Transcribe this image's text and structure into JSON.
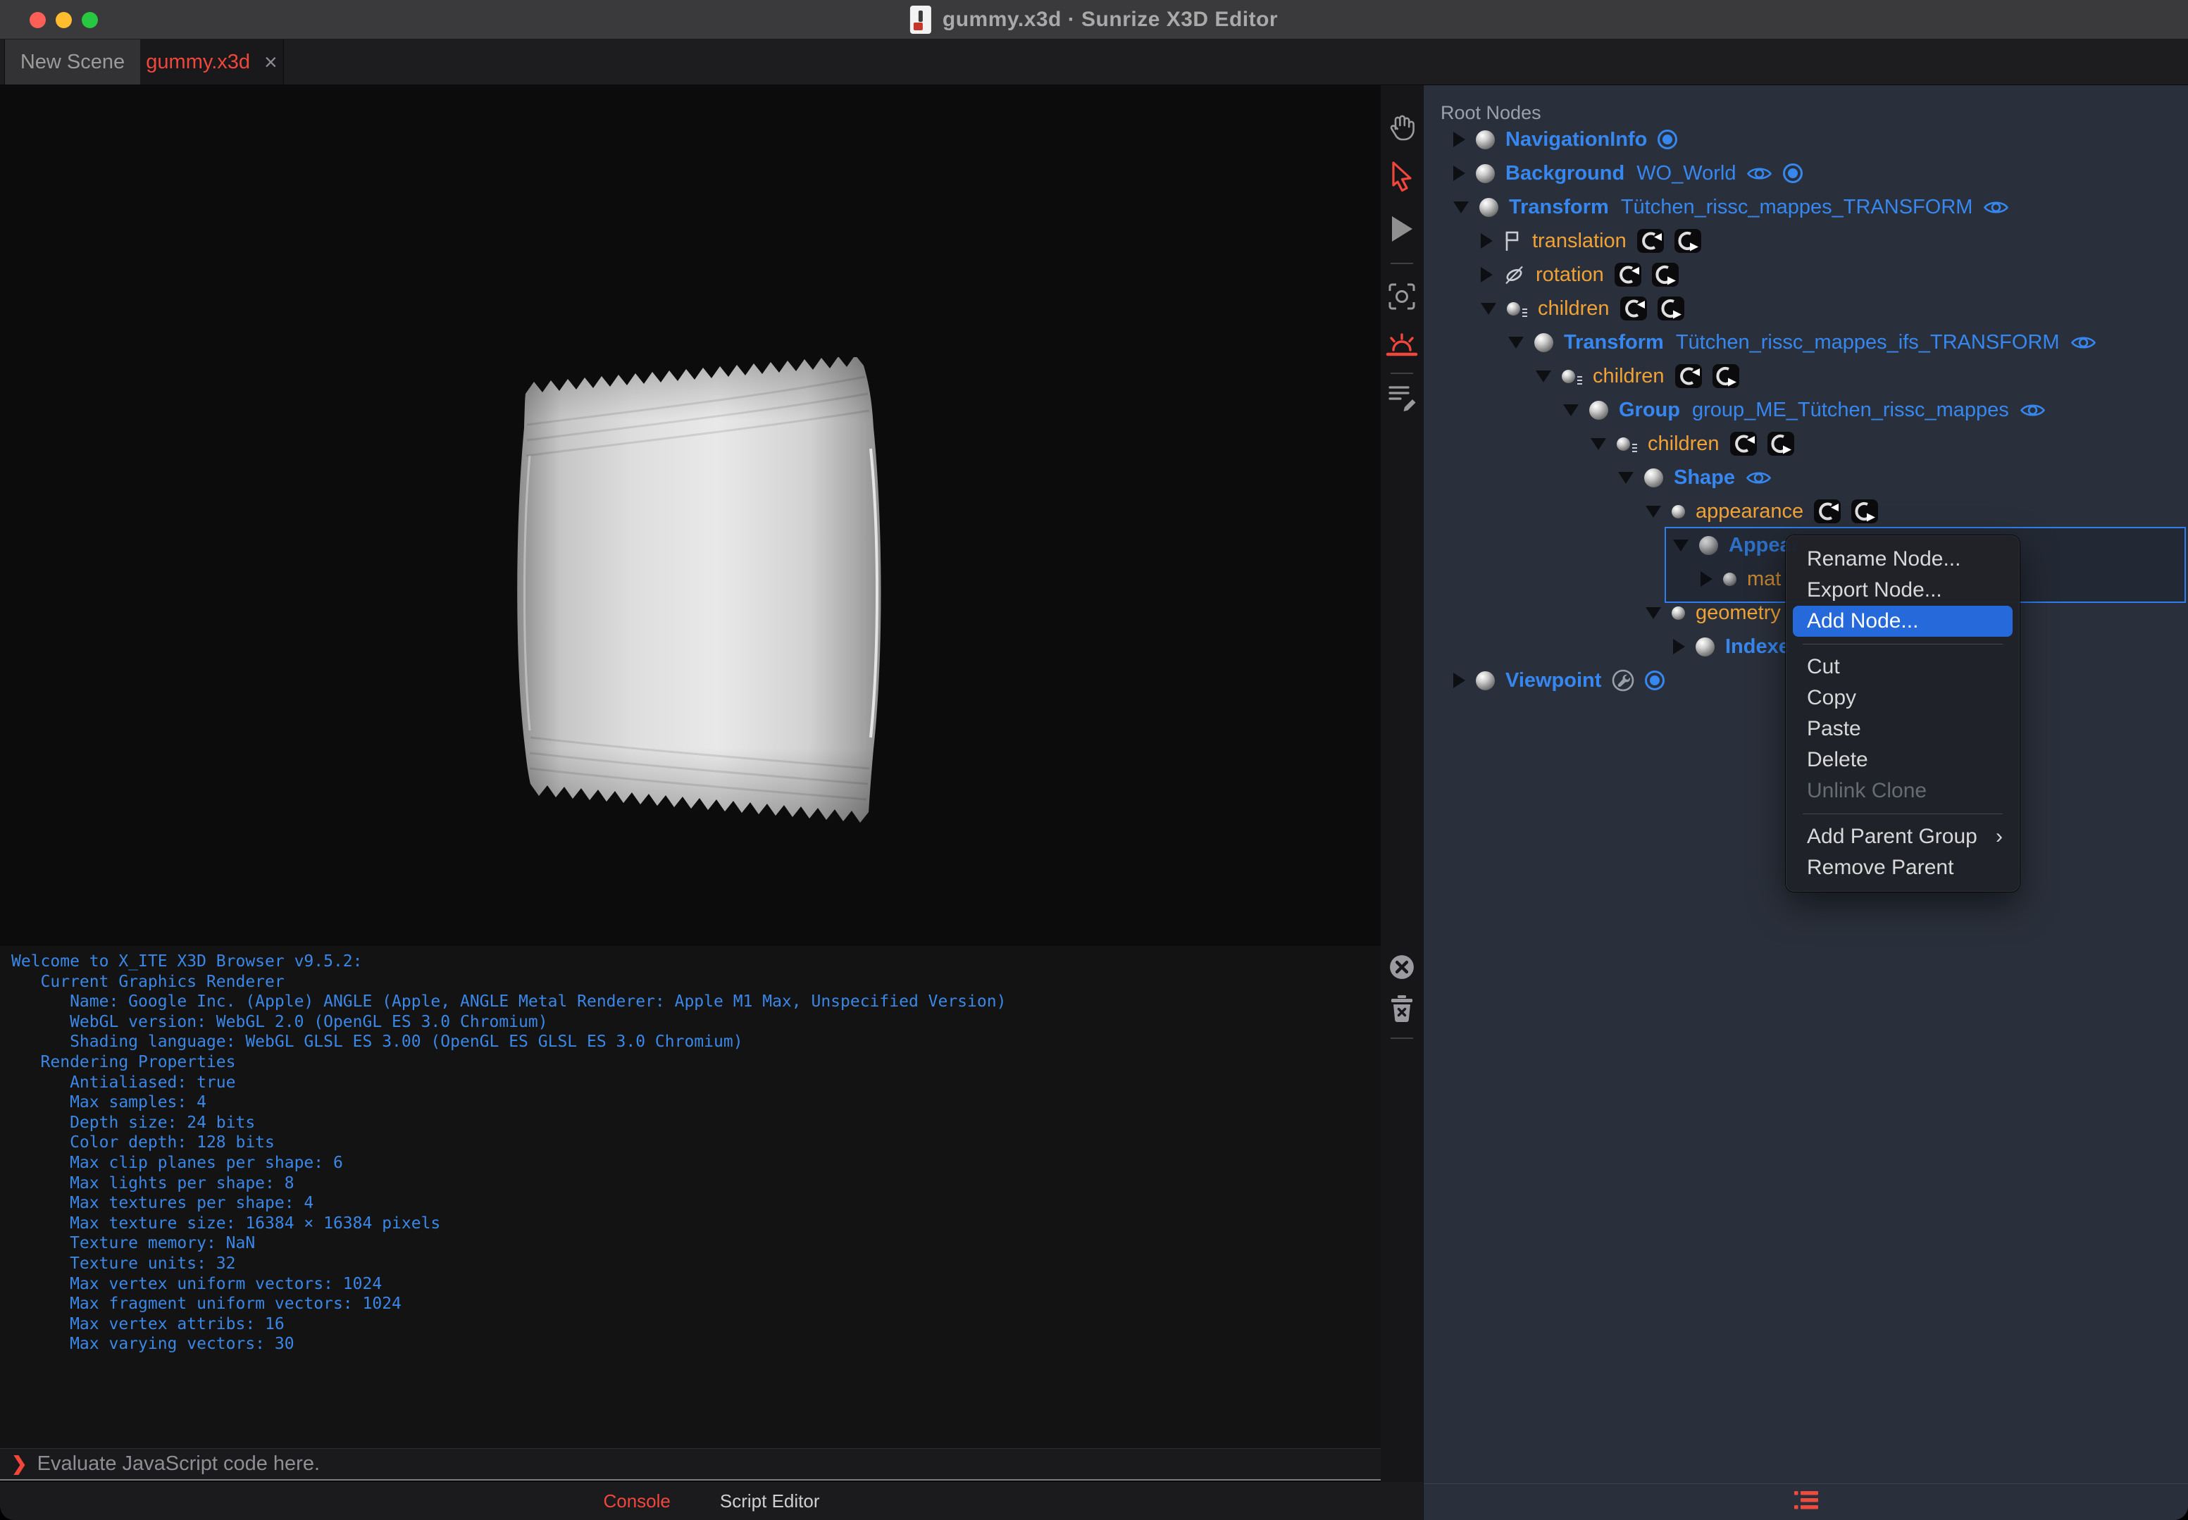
{
  "window": {
    "title": "gummy.x3d · Sunrize X3D Editor"
  },
  "traffic_lights": [
    {
      "name": "close"
    },
    {
      "name": "minimize"
    },
    {
      "name": "zoom"
    }
  ],
  "tabs": [
    {
      "label": "New Scene",
      "active": false
    },
    {
      "label": "gummy.x3d",
      "active": true,
      "close_glyph": "×"
    }
  ],
  "side_toolbar": {
    "buttons": [
      {
        "icon": "pan-hand-icon",
        "active": false
      },
      {
        "icon": "select-arrow-icon",
        "active": true
      },
      {
        "icon": "play-icon",
        "active": false
      },
      {
        "icon": "divider"
      },
      {
        "icon": "snapshot-center-icon",
        "active": false
      },
      {
        "icon": "sunrise-light-icon",
        "active": true
      },
      {
        "icon": "divider"
      },
      {
        "icon": "script-edit-icon",
        "active": false
      }
    ],
    "console_buttons": [
      {
        "icon": "clear-console-icon"
      },
      {
        "icon": "delete-messages-icon"
      },
      {
        "icon": "divider"
      }
    ]
  },
  "outline": {
    "header": "Root Nodes",
    "footer_icon": "outline-list-icon",
    "rows": [
      {
        "level": 0,
        "kind": "node",
        "expanded": false,
        "type": "NavigationInfo",
        "name": "",
        "badges": [
          "bound"
        ]
      },
      {
        "level": 0,
        "kind": "node",
        "expanded": false,
        "type": "Background",
        "name": "WO_World",
        "badges": [
          "eye",
          "bound"
        ]
      },
      {
        "level": 0,
        "kind": "node",
        "expanded": true,
        "type": "Transform",
        "name": "Tütchen_rissc_mappes_TRANSFORM",
        "badges": [
          "eye"
        ]
      },
      {
        "level": 1,
        "kind": "field",
        "expanded": false,
        "icon": "translation",
        "label": "translation",
        "badges": [
          "route-in",
          "route-out"
        ]
      },
      {
        "level": 1,
        "kind": "field",
        "expanded": false,
        "icon": "rotation",
        "label": "rotation",
        "badges": [
          "route-in",
          "route-out"
        ]
      },
      {
        "level": 1,
        "kind": "field",
        "expanded": true,
        "icon": "children",
        "label": "children",
        "badges": [
          "route-in",
          "route-out"
        ]
      },
      {
        "level": 2,
        "kind": "node",
        "expanded": true,
        "type": "Transform",
        "name": "Tütchen_rissc_mappes_ifs_TRANSFORM",
        "badges": [
          "eye"
        ]
      },
      {
        "level": 3,
        "kind": "field",
        "expanded": true,
        "icon": "children",
        "label": "children",
        "badges": [
          "route-in",
          "route-out"
        ]
      },
      {
        "level": 4,
        "kind": "node",
        "expanded": true,
        "type": "Group",
        "name": "group_ME_Tütchen_rissc_mappes",
        "badges": [
          "eye"
        ]
      },
      {
        "level": 5,
        "kind": "field",
        "expanded": true,
        "icon": "children",
        "label": "children",
        "badges": [
          "route-in",
          "route-out"
        ]
      },
      {
        "level": 6,
        "kind": "node",
        "expanded": true,
        "type": "Shape",
        "name": "",
        "badges": [
          "eye"
        ]
      },
      {
        "level": 7,
        "kind": "field",
        "expanded": true,
        "icon": "field-sphere",
        "label": "appearance",
        "badges": [
          "route-in",
          "route-out"
        ]
      },
      {
        "level": 8,
        "kind": "node",
        "expanded": true,
        "type": "Appear",
        "name": "",
        "badges": [],
        "selected": true,
        "clipped": true
      },
      {
        "level": 9,
        "kind": "field",
        "expanded": false,
        "icon": "field-sphere",
        "label": "mat",
        "badges": [],
        "selected": true,
        "clipped": true
      },
      {
        "level": 7,
        "kind": "field",
        "expanded": true,
        "icon": "field-sphere",
        "label": "geometry",
        "badges": []
      },
      {
        "level": 8,
        "kind": "node",
        "expanded": false,
        "type": "Indexe",
        "name": "",
        "badges": [],
        "clipped": true
      },
      {
        "level": 0,
        "kind": "node",
        "expanded": false,
        "type": "Viewpoint",
        "name": "",
        "badges": [
          "wrench",
          "bound"
        ]
      }
    ]
  },
  "context_menu": {
    "items": [
      {
        "type": "item",
        "label": "Rename Node..."
      },
      {
        "type": "item",
        "label": "Export Node..."
      },
      {
        "type": "item",
        "label": "Add Node...",
        "state": "highlighted"
      },
      {
        "type": "separator"
      },
      {
        "type": "item",
        "label": "Cut"
      },
      {
        "type": "item",
        "label": "Copy"
      },
      {
        "type": "item",
        "label": "Paste"
      },
      {
        "type": "item",
        "label": "Delete"
      },
      {
        "type": "item",
        "label": "Unlink Clone",
        "state": "disabled"
      },
      {
        "type": "separator"
      },
      {
        "type": "item",
        "label": "Add Parent Group",
        "submenu": true,
        "submenu_glyph": "›"
      },
      {
        "type": "item",
        "label": "Remove Parent"
      }
    ]
  },
  "console": {
    "prompt": "❯",
    "placeholder": "Evaluate JavaScript code here.",
    "lines": [
      "Welcome to X_ITE X3D Browser v9.5.2:",
      "   Current Graphics Renderer",
      "      Name: Google Inc. (Apple) ANGLE (Apple, ANGLE Metal Renderer: Apple M1 Max, Unspecified Version)",
      "      WebGL version: WebGL 2.0 (OpenGL ES 3.0 Chromium)",
      "      Shading language: WebGL GLSL ES 3.00 (OpenGL ES GLSL ES 3.0 Chromium)",
      "   Rendering Properties",
      "      Antialiased: true",
      "      Max samples: 4",
      "      Depth size: 24 bits",
      "      Color depth: 128 bits",
      "      Max clip planes per shape: 6",
      "      Max lights per shape: 8",
      "      Max textures per shape: 4",
      "      Max texture size: 16384 × 16384 pixels",
      "      Texture memory: NaN",
      "      Texture units: 32",
      "      Max vertex uniform vectors: 1024",
      "      Max fragment uniform vectors: 1024",
      "      Max vertex attribs: 16",
      "      Max varying vectors: 30"
    ]
  },
  "bottom_tabs": [
    {
      "label": "Console",
      "active": true
    },
    {
      "label": "Script Editor",
      "active": false
    }
  ],
  "colors": {
    "accent_red": "#f0463c",
    "node_blue": "#3687f0",
    "field_orange": "#f0a236",
    "menu_highlight": "#2569db",
    "console_blue": "#3a87e8",
    "panel_bg": "#2a303b"
  }
}
